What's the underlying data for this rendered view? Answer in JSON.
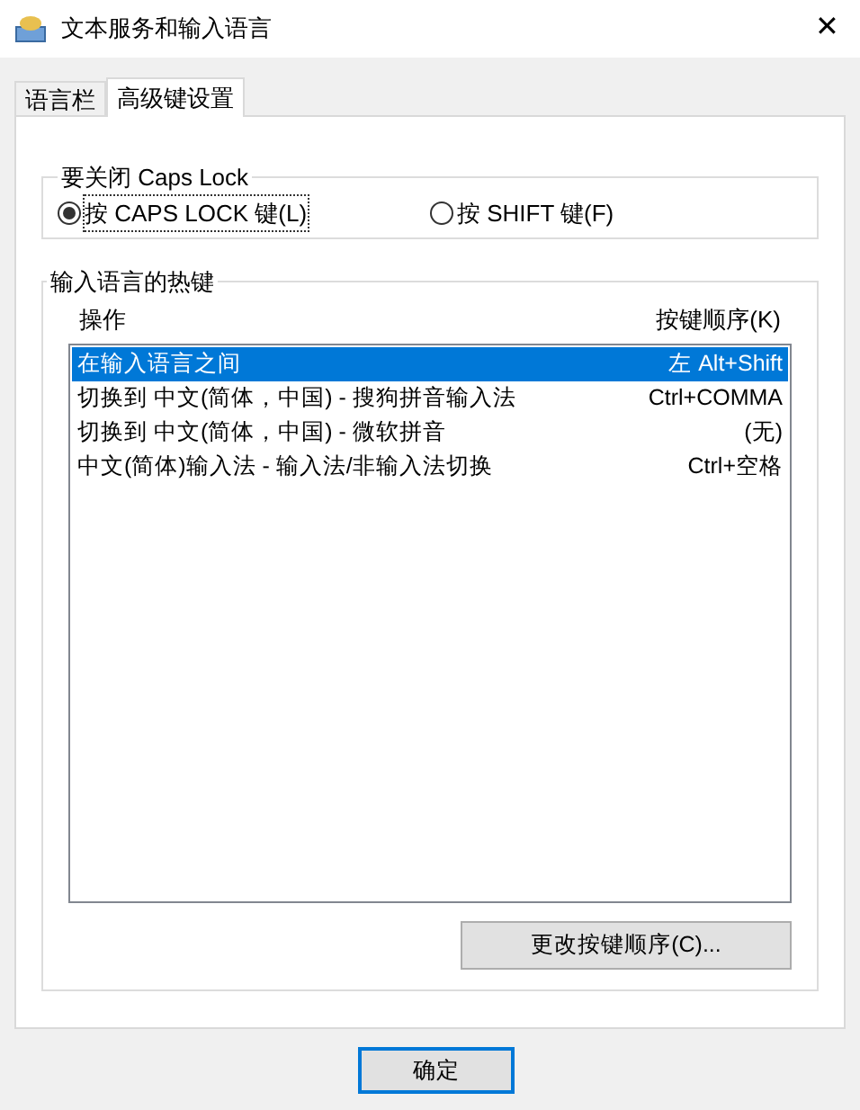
{
  "window": {
    "title": "文本服务和输入语言",
    "close": "✕"
  },
  "tabs": [
    {
      "label": "语言栏",
      "selected": false
    },
    {
      "label": "高级键设置",
      "selected": true
    }
  ],
  "caps_lock_group": {
    "title": "要关闭 Caps Lock",
    "options": [
      {
        "label": "按 CAPS LOCK 键(L)",
        "selected": true
      },
      {
        "label": "按 SHIFT 键(F)",
        "selected": false
      }
    ]
  },
  "hotkeys_group": {
    "title": "输入语言的热键",
    "columns": [
      "操作",
      "按键顺序(K)"
    ],
    "rows": [
      {
        "action": "在输入语言之间",
        "keys": "左 Alt+Shift",
        "selected": true
      },
      {
        "action": "切换到 中文(简体，中国) - 搜狗拼音输入法",
        "keys": "Ctrl+COMMA",
        "selected": false
      },
      {
        "action": "切换到 中文(简体，中国) - 微软拼音",
        "keys": "(无)",
        "selected": false
      },
      {
        "action": "中文(简体)输入法 - 输入法/非输入法切换",
        "keys": "Ctrl+空格",
        "selected": false
      }
    ],
    "change_button": "更改按键顺序(C)..."
  },
  "buttons": [
    "确定"
  ]
}
